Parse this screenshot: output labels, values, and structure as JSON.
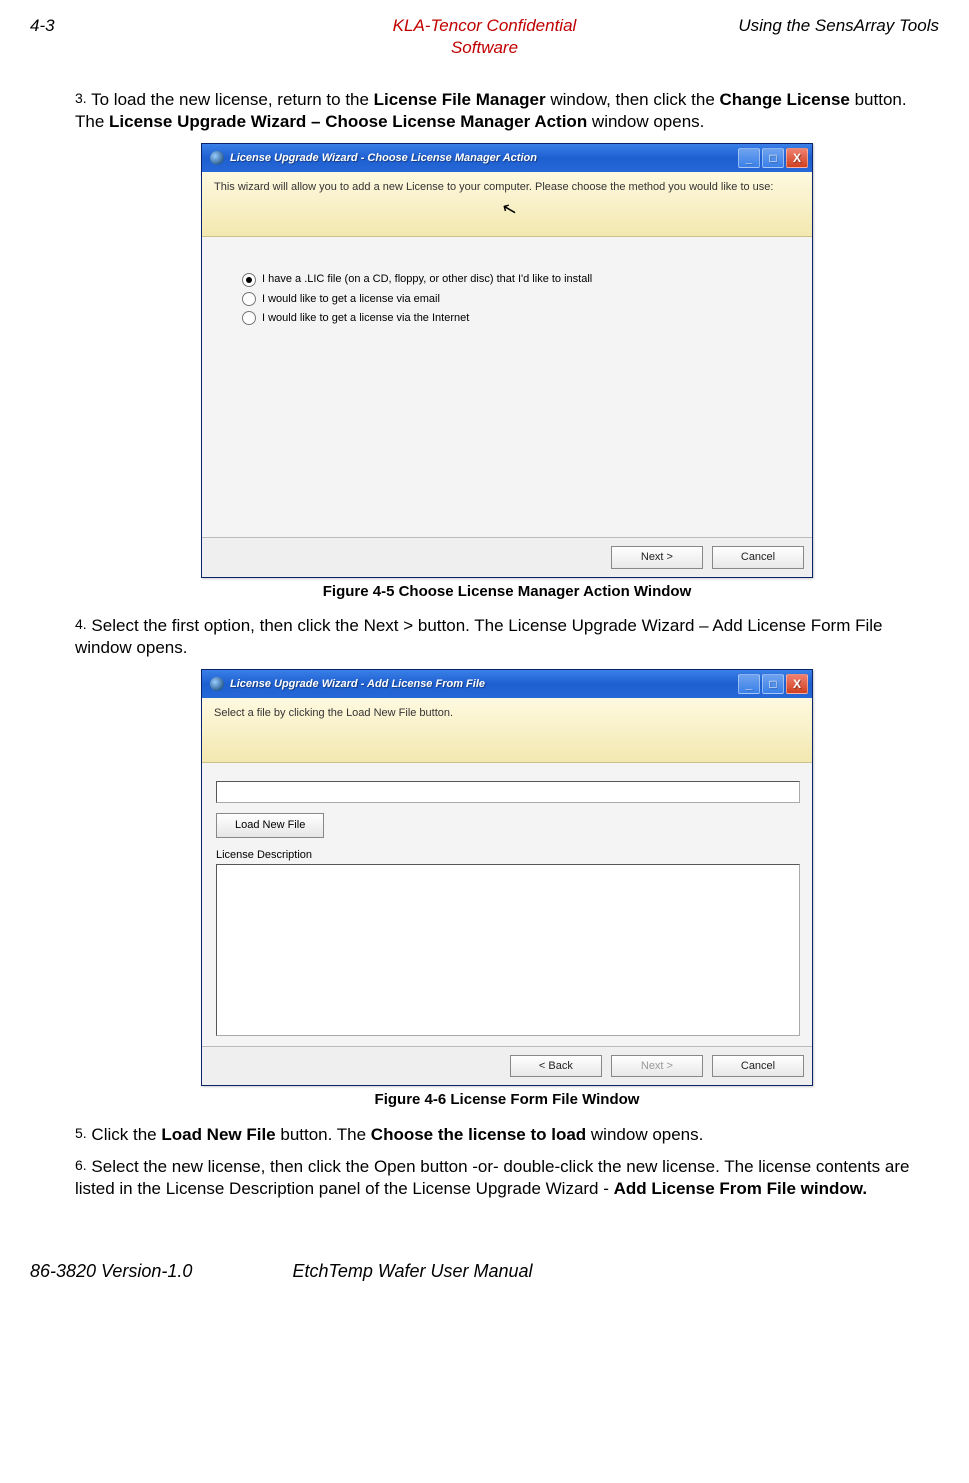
{
  "header": {
    "left": "4-3",
    "center_line1": "KLA-Tencor Confidential",
    "center_line2": "Software",
    "right": "Using the SensArray Tools"
  },
  "steps": {
    "s3_num": "3.",
    "s3_a": "To load the new license, return to the ",
    "s3_b": "License File Manager",
    "s3_c": " window, then click the ",
    "s3_d": "Change License",
    "s3_e": " button. The ",
    "s3_f": "License Upgrade Wizard – Choose License Manager Action",
    "s3_g": " window opens.",
    "s4_num": "4.",
    "s4_text": "Select the first option, then click the Next > button. The License Upgrade Wizard – Add License Form File window opens.",
    "s5_num": "5.",
    "s5_a": "Click the ",
    "s5_b": "Load New File",
    "s5_c": " button. The ",
    "s5_d": "Choose the license to load",
    "s5_e": " window opens.",
    "s6_num": "6.",
    "s6_a": "Select the new license, then click the Open button -or- double-click the new license. The license contents are listed in the License Description panel of the License Upgrade Wizard - ",
    "s6_b": "Add License From File window."
  },
  "captions": {
    "fig1": "Figure 4-5 Choose License Manager Action Window",
    "fig2": "Figure 4-6 License Form File Window"
  },
  "dialog1": {
    "title": "License Upgrade Wizard - Choose License Manager Action",
    "banner": "This wizard will allow you to add a new License to your computer. Please choose the method you would like to use:",
    "opt1": "I have a .LIC file (on a CD, floppy, or other disc) that I'd like to install",
    "opt2": "I would like to get a license via email",
    "opt3": "I would like to get a license via the Internet",
    "next": "Next >",
    "cancel": "Cancel"
  },
  "dialog2": {
    "title": "License Upgrade Wizard - Add License From File",
    "banner": "Select a file by clicking the Load New File button.",
    "load": "Load New File",
    "desc_label": "License Description",
    "back": "< Back",
    "next": "Next >",
    "cancel": "Cancel"
  },
  "footer": {
    "left": "86-3820 Version-1.0",
    "center": "EtchTemp Wafer User Manual"
  }
}
